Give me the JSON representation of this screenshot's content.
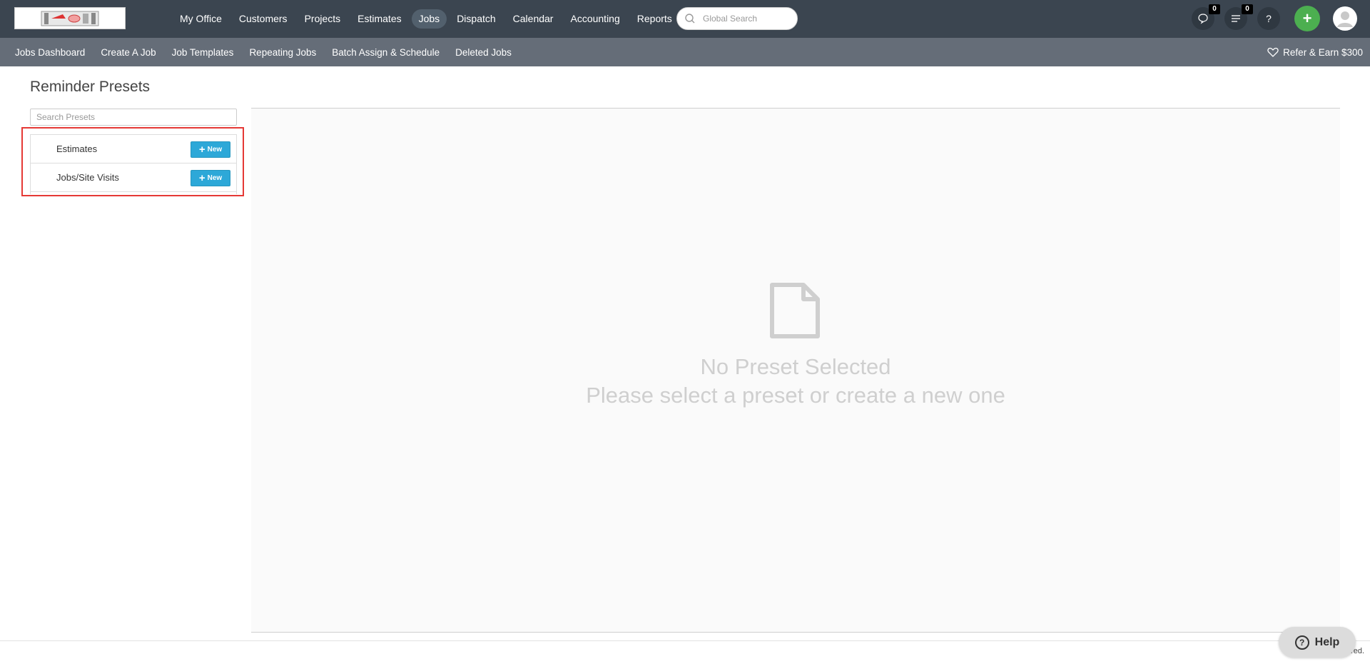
{
  "topnav": {
    "items": [
      {
        "label": "My Office"
      },
      {
        "label": "Customers"
      },
      {
        "label": "Projects"
      },
      {
        "label": "Estimates"
      },
      {
        "label": "Jobs",
        "active": true
      },
      {
        "label": "Dispatch"
      },
      {
        "label": "Calendar"
      },
      {
        "label": "Accounting"
      },
      {
        "label": "Reports"
      }
    ],
    "search_placeholder": "Global Search",
    "chat_count": "0",
    "notifications_count": "0",
    "help_label": "?",
    "add_label": "+"
  },
  "subnav": {
    "items": [
      {
        "label": "Jobs Dashboard"
      },
      {
        "label": "Create A Job"
      },
      {
        "label": "Job Templates"
      },
      {
        "label": "Repeating Jobs"
      },
      {
        "label": "Batch Assign & Schedule"
      },
      {
        "label": "Deleted Jobs"
      }
    ],
    "refer_label": "Refer & Earn $300"
  },
  "page": {
    "title": "Reminder Presets",
    "search_placeholder": "Search Presets",
    "presets": [
      {
        "label": "Estimates",
        "button": "New"
      },
      {
        "label": "Jobs/Site Visits",
        "button": "New"
      }
    ],
    "empty_title": "No Preset Selected",
    "empty_sub": "Please select a preset or create a new one"
  },
  "footer": {
    "copyright": "Copyright 20          ved.",
    "help_label": "Help"
  },
  "colors": {
    "topbar": "#3b4550",
    "subbar": "#656d78",
    "new_button": "#2da8d8",
    "annotation": "#e53935",
    "add_button": "#4caf50"
  }
}
